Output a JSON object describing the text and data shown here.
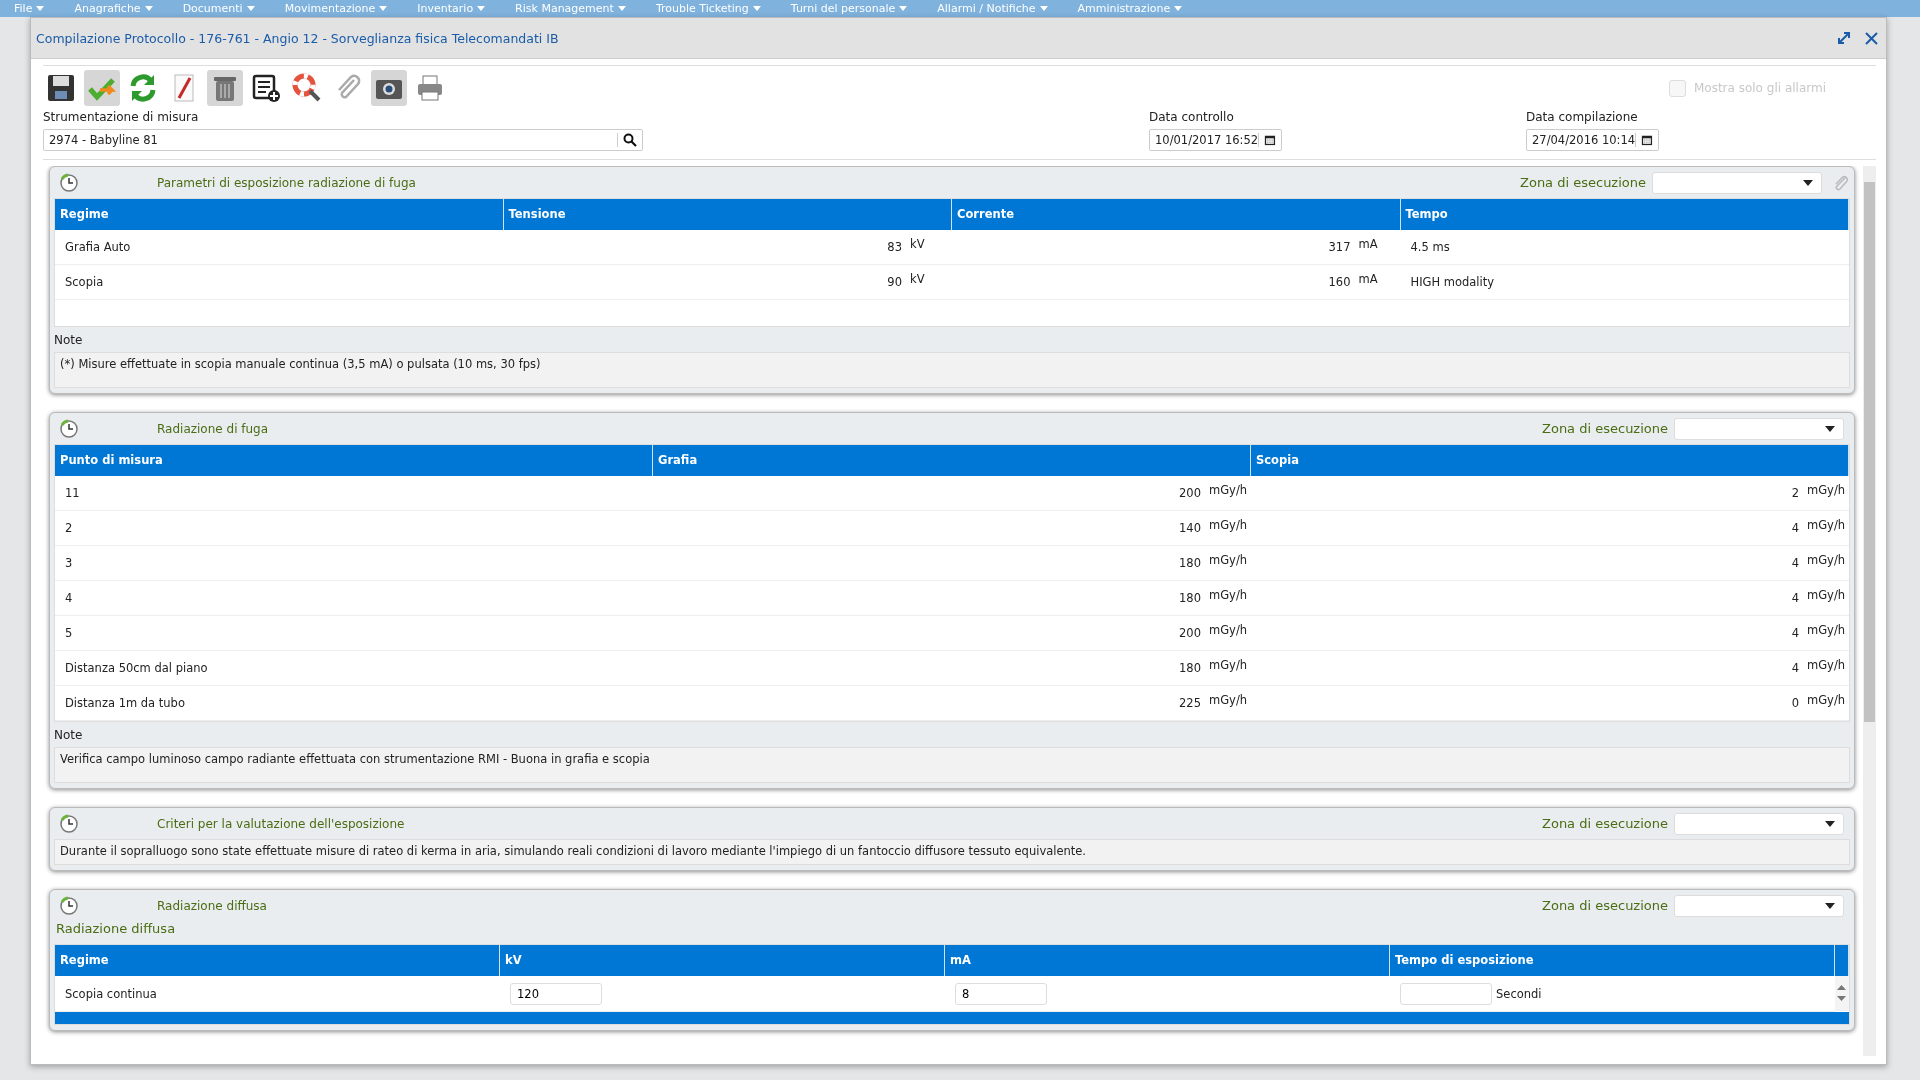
{
  "menu_bar": [
    "File",
    "Anagrafiche",
    "Documenti",
    "Movimentazione",
    "Inventario",
    "Risk Management",
    "Trouble Ticketing",
    "Turni del personale",
    "Allarmi / Notifiche",
    "Amministrazione"
  ],
  "window": {
    "title": "Compilazione Protocollo - 176-761 - Angio 12 - Sorveglianza fisica Telecomandati IB"
  },
  "show_alarms_only": {
    "label": "Mostra solo gli allarmi",
    "checked": false,
    "disabled": true
  },
  "instrument": {
    "label": "Strumentazione di misura",
    "value": "2974 - Babyline 81"
  },
  "check_date": {
    "label": "Data controllo",
    "value": "10/01/2017 16:52"
  },
  "compile_date": {
    "label": "Data compilazione",
    "value": "27/04/2016 10:14"
  },
  "sections": [
    {
      "kind": "table",
      "title": "Parametri di esposizione radiazione di fuga",
      "zone_label": "Zona di esecuzione",
      "attachment": true,
      "columns": [
        "Regime",
        "Tensione",
        "Corrente",
        "Tempo"
      ],
      "rows": [
        [
          {
            "value": "Grafia Auto"
          },
          {
            "value": "83",
            "unit": "kV"
          },
          {
            "value": "317",
            "unit": "mA"
          },
          {
            "value": "4.5 ms"
          }
        ],
        [
          {
            "value": "Scopia"
          },
          {
            "value": "90",
            "unit": "kV"
          },
          {
            "value": "160",
            "unit": "mA"
          },
          {
            "value": "HIGH modality"
          }
        ]
      ],
      "note_label": "Note",
      "note": "(*) Misure effettuate in scopia manuale continua (3,5 mA) o pulsata (10 ms, 30 fps)"
    },
    {
      "kind": "table",
      "title": "Radiazione di fuga",
      "zone_label": "Zona di esecuzione",
      "attachment": false,
      "columns": [
        "Punto di misura",
        "Grafia",
        "Scopia"
      ],
      "rows": [
        [
          {
            "value": "11"
          },
          {
            "value": "200",
            "unit": "mGy/h"
          },
          {
            "value": "2",
            "unit": "mGy/h"
          }
        ],
        [
          {
            "value": "2"
          },
          {
            "value": "140",
            "unit": "mGy/h"
          },
          {
            "value": "4",
            "unit": "mGy/h"
          }
        ],
        [
          {
            "value": "3"
          },
          {
            "value": "180",
            "unit": "mGy/h"
          },
          {
            "value": "4",
            "unit": "mGy/h"
          }
        ],
        [
          {
            "value": "4"
          },
          {
            "value": "180",
            "unit": "mGy/h"
          },
          {
            "value": "4",
            "unit": "mGy/h"
          }
        ],
        [
          {
            "value": "5"
          },
          {
            "value": "200",
            "unit": "mGy/h"
          },
          {
            "value": "4",
            "unit": "mGy/h"
          }
        ],
        [
          {
            "value": "Distanza 50cm dal piano"
          },
          {
            "value": "180",
            "unit": "mGy/h"
          },
          {
            "value": "4",
            "unit": "mGy/h"
          }
        ],
        [
          {
            "value": "Distanza 1m da tubo"
          },
          {
            "value": "225",
            "unit": "mGy/h"
          },
          {
            "value": "0",
            "unit": "mGy/h"
          }
        ]
      ],
      "note_label": "Note",
      "note": "Verifica campo luminoso campo radiante effettuata con strumentazione RMI - Buona in grafia e scopia"
    },
    {
      "kind": "text",
      "title": "Criteri per la valutazione dell'esposizione",
      "zone_label": "Zona di esecuzione",
      "text": "Durante il sopralluogo sono state effettuate misure di rateo di kerma in aria, simulando reali condizioni di lavoro mediante l'impiego di un fantoccio diffusore tessuto equivalente."
    },
    {
      "kind": "inputs",
      "title": "Radiazione diffusa",
      "zone_label": "Zona di esecuzione",
      "subtitle": "Radiazione diffusa",
      "columns": [
        "Regime",
        "kV",
        "mA",
        "Tempo di esposizione"
      ],
      "rows": [
        [
          {
            "kind": "text",
            "value": "Scopia continua"
          },
          {
            "kind": "input",
            "value": "120"
          },
          {
            "kind": "input",
            "value": "8"
          },
          {
            "kind": "input",
            "unit": "Secondi"
          }
        ]
      ]
    }
  ]
}
